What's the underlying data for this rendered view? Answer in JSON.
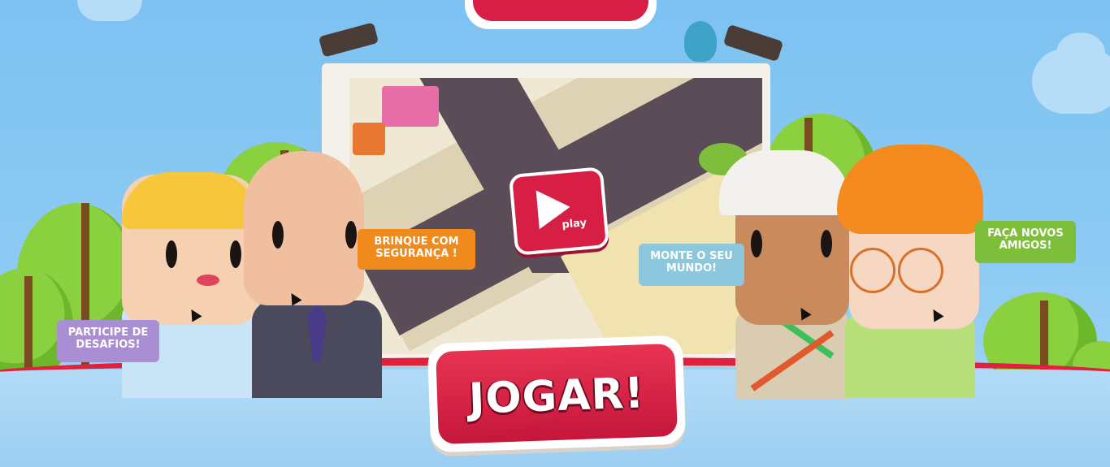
{
  "colors": {
    "sky": "#7cc2f2",
    "brand_red": "#d71f46",
    "bubble_orange": "#f08a1c",
    "bubble_blue": "#8cc7dd",
    "bubble_green": "#7dbf3a",
    "bubble_purple": "#a98ed3"
  },
  "billboard": {
    "play_label": "play",
    "play_icon": "play-triangle-icon"
  },
  "bubbles": {
    "brinque": "BRINQUE COM SEGURANÇA !",
    "participe": "PARTICIPE DE DESAFIOS!",
    "monte": "MONTE O SEU MUNDO!",
    "faca": "FAÇA NOVOS AMIGOS!"
  },
  "cta": {
    "jogar_label": "JOGAR!"
  }
}
